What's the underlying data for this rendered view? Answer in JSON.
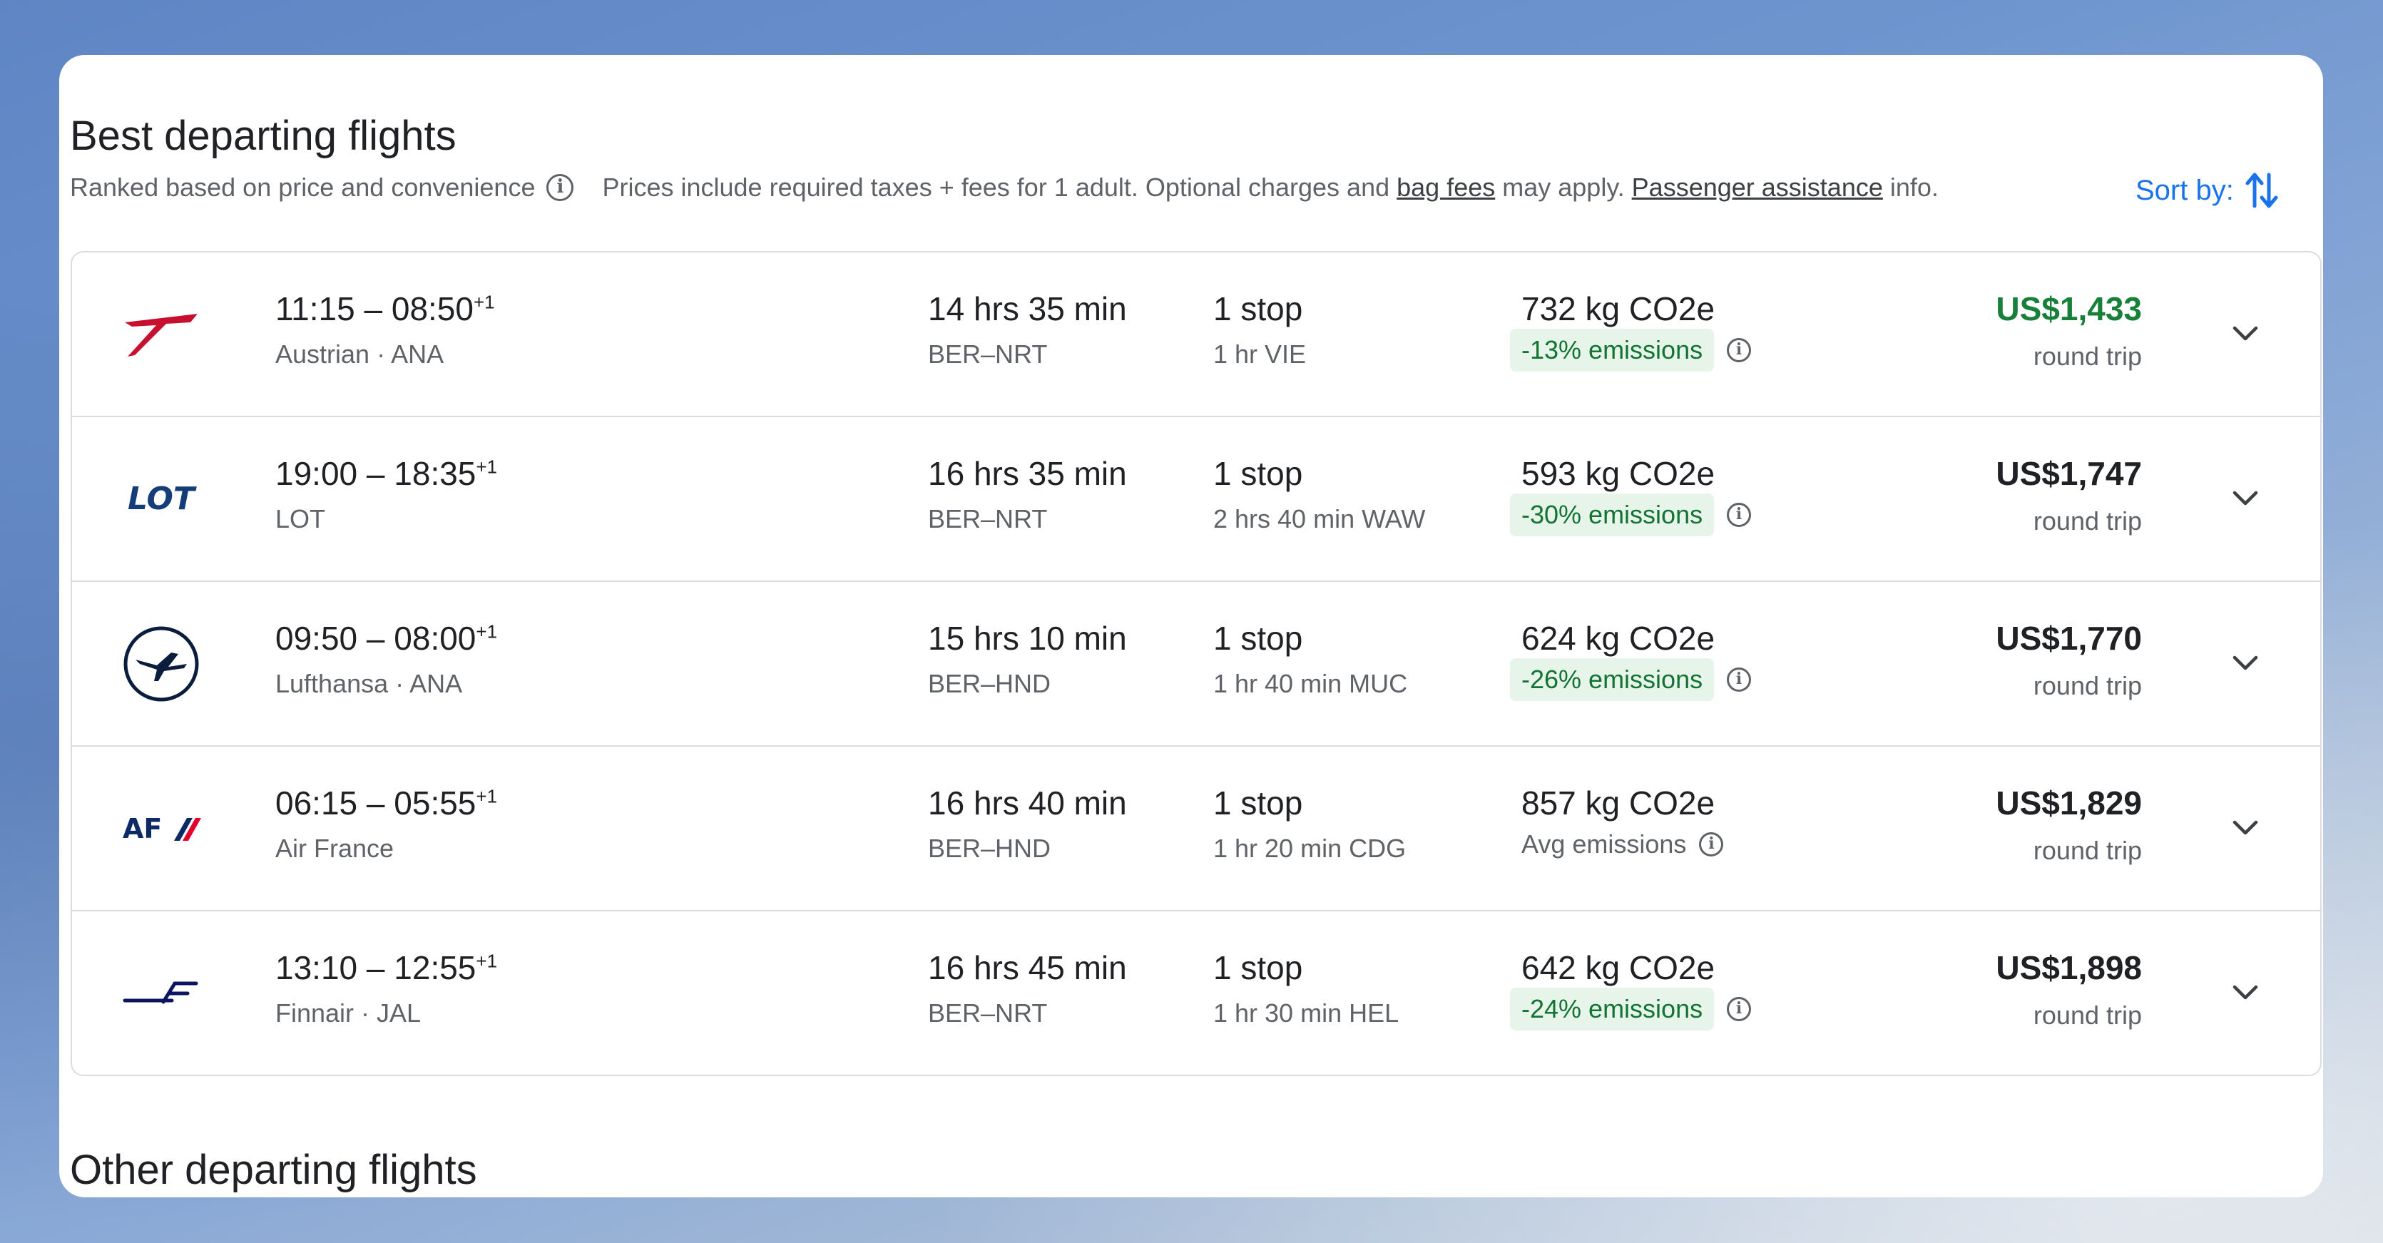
{
  "section_title": "Best departing flights",
  "ranking_note": "Ranked based on price and convenience",
  "prices_note": {
    "before": "Prices include required taxes + fees for 1 adult. Optional charges and ",
    "bag_fees": "bag fees",
    "middle": " may apply. ",
    "passenger_assistance": "Passenger assistance",
    "after": " info."
  },
  "sort_label": "Sort by:",
  "other_title": "Other departing flights",
  "info_glyph": "i",
  "colors": {
    "accent": "#1a73e8",
    "price_green": "#188038",
    "badge_bg": "#e6f4ea",
    "badge_text": "#137333"
  },
  "flights": [
    {
      "logo": "austrian-logo",
      "depart": "11:15",
      "arrive": "08:50",
      "day_offset": "+1",
      "carrier": "Austrian · ANA",
      "duration": "14 hrs 35 min",
      "route": "BER–NRT",
      "stops": "1 stop",
      "layover": "1 hr VIE",
      "co2": "732 kg CO2e",
      "emissions": "-13% emissions",
      "price": "US$1,433",
      "price_type": "round trip"
    },
    {
      "logo": "lot-logo",
      "depart": "19:00",
      "arrive": "18:35",
      "day_offset": "+1",
      "carrier": "LOT",
      "duration": "16 hrs 35 min",
      "route": "BER–NRT",
      "stops": "1 stop",
      "layover": "2 hrs 40 min WAW",
      "co2": "593 kg CO2e",
      "emissions": "-30% emissions",
      "price": "US$1,747",
      "price_type": "round trip"
    },
    {
      "logo": "lufthansa-logo",
      "depart": "09:50",
      "arrive": "08:00",
      "day_offset": "+1",
      "carrier": "Lufthansa · ANA",
      "duration": "15 hrs 10 min",
      "route": "BER–HND",
      "stops": "1 stop",
      "layover": "1 hr 40 min MUC",
      "co2": "624 kg CO2e",
      "emissions": "-26% emissions",
      "price": "US$1,770",
      "price_type": "round trip"
    },
    {
      "logo": "airfrance-logo",
      "depart": "06:15",
      "arrive": "05:55",
      "day_offset": "+1",
      "carrier": "Air France",
      "duration": "16 hrs 40 min",
      "route": "BER–HND",
      "stops": "1 stop",
      "layover": "1 hr 20 min CDG",
      "co2": "857 kg CO2e",
      "emissions": "Avg emissions",
      "price": "US$1,829",
      "price_type": "round trip"
    },
    {
      "logo": "finnair-logo",
      "depart": "13:10",
      "arrive": "12:55",
      "day_offset": "+1",
      "carrier": "Finnair · JAL",
      "duration": "16 hrs 45 min",
      "route": "BER–NRT",
      "stops": "1 stop",
      "layover": "1 hr 30 min HEL",
      "co2": "642 kg CO2e",
      "emissions": "-24% emissions",
      "price": "US$1,898",
      "price_type": "round trip"
    }
  ]
}
